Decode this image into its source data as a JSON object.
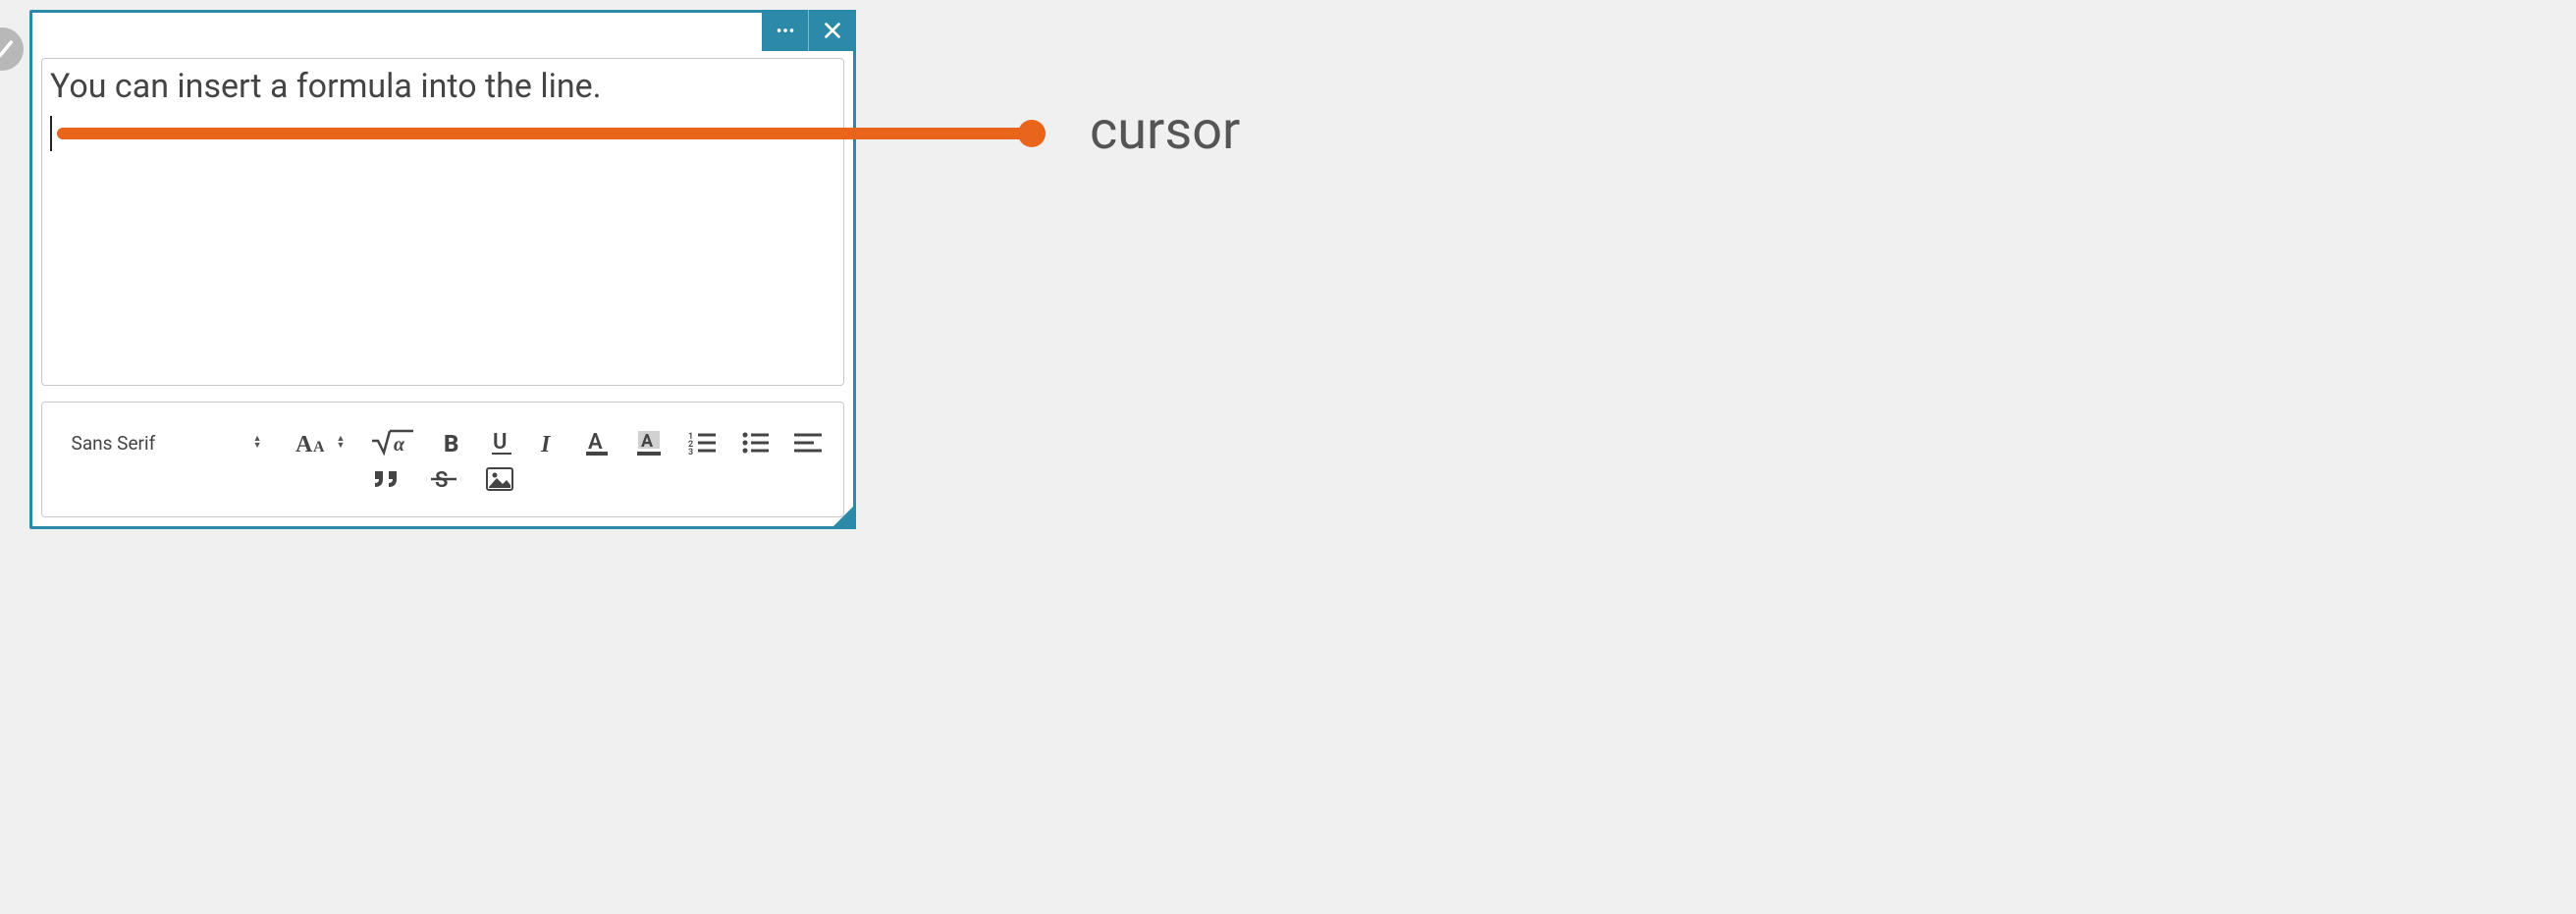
{
  "editor": {
    "content_line1": "You can insert a formula into the line.",
    "font_family": "Sans Serif"
  },
  "annotation": {
    "cursor_label": "cursor"
  },
  "titlebar": {
    "more": "more-options",
    "close": "close"
  },
  "toolbar": {
    "font_size": "font-size",
    "formula": "insert-formula",
    "bold": "B",
    "underline": "U",
    "italic": "I",
    "text_color": "text-color",
    "highlight": "highlight-color",
    "ol": "ordered-list",
    "ul": "unordered-list",
    "align": "alignment",
    "quote": "blockquote",
    "strike": "strikethrough",
    "image": "insert-image"
  }
}
